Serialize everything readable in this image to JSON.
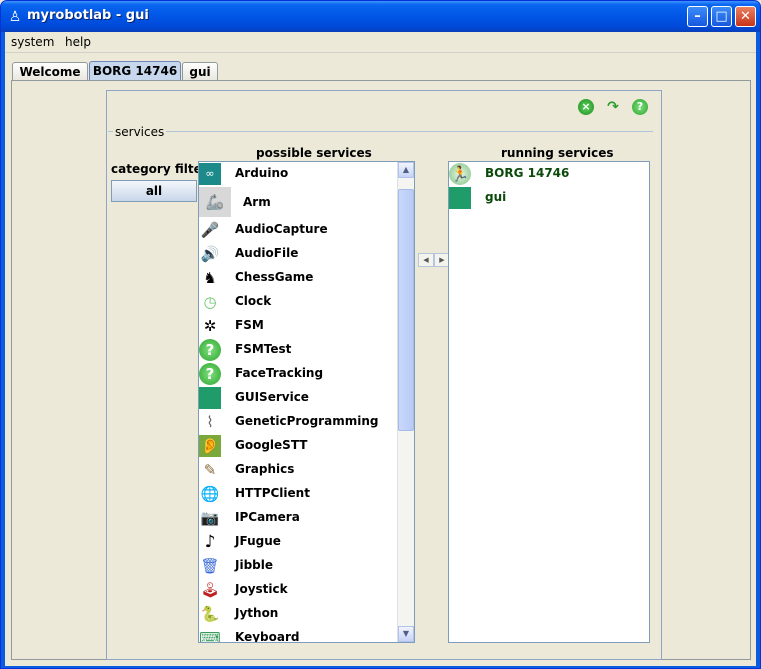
{
  "window": {
    "title": "myrobotlab - gui"
  },
  "menu": {
    "system": "system",
    "help": "help"
  },
  "tabs": [
    {
      "label": "Welcome"
    },
    {
      "label": "BORG 14746"
    },
    {
      "label": "gui"
    }
  ],
  "panel": {
    "section_label": "services",
    "category_filters_label": "category filters",
    "all_button": "all",
    "possible_services_header": "possible services",
    "running_services_header": "running services"
  },
  "possible_services": [
    {
      "name": "Arduino",
      "icon": "arduino-icon"
    },
    {
      "name": "Arm",
      "icon": "arm-icon"
    },
    {
      "name": "AudioCapture",
      "icon": "microphone-icon"
    },
    {
      "name": "AudioFile",
      "icon": "speaker-icon"
    },
    {
      "name": "ChessGame",
      "icon": "chess-icon"
    },
    {
      "name": "Clock",
      "icon": "clock-icon"
    },
    {
      "name": "FSM",
      "icon": "fsm-icon"
    },
    {
      "name": "FSMTest",
      "icon": "help-icon"
    },
    {
      "name": "FaceTracking",
      "icon": "help-icon"
    },
    {
      "name": "GUIService",
      "icon": "monitor-icon"
    },
    {
      "name": "GeneticProgramming",
      "icon": "genetic-icon"
    },
    {
      "name": "GoogleSTT",
      "icon": "ear-icon"
    },
    {
      "name": "Graphics",
      "icon": "graphics-icon"
    },
    {
      "name": "HTTPClient",
      "icon": "http-icon"
    },
    {
      "name": "IPCamera",
      "icon": "camera-icon"
    },
    {
      "name": "JFugue",
      "icon": "music-note-icon"
    },
    {
      "name": "Jibble",
      "icon": "jibble-icon"
    },
    {
      "name": "Joystick",
      "icon": "joystick-icon"
    },
    {
      "name": "Jython",
      "icon": "python-icon"
    },
    {
      "name": "Keyboard",
      "icon": "keyboard-icon"
    }
  ],
  "running_services": [
    {
      "name": "BORG 14746",
      "icon": "runtime-icon"
    },
    {
      "name": "gui",
      "icon": "monitor-icon"
    }
  ],
  "colors": {
    "title_bar": "#0055e5",
    "tab_active": "#c7d8ee",
    "running_text": "#0b4a0b"
  }
}
